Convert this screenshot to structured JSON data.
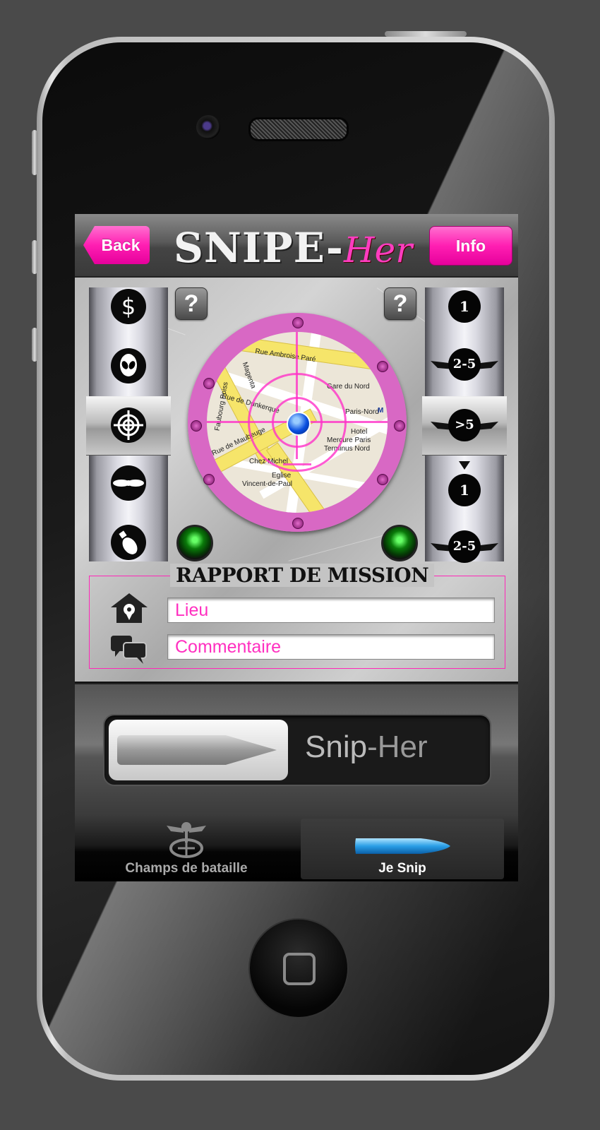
{
  "nav": {
    "back_label": "Back",
    "info_label": "Info",
    "logo_main": "SNIPE-",
    "logo_accent": "Her"
  },
  "left_dial": {
    "icons": [
      "dollar-icon",
      "alien-icon",
      "crosshair-icon",
      "propeller-icon",
      "bomb-icon"
    ],
    "selected": "crosshair-icon"
  },
  "right_dial": {
    "items": [
      "1",
      "2-5",
      ">5",
      "1",
      "2-5"
    ],
    "selected": ">5"
  },
  "help_label": "?",
  "map": {
    "streets": [
      "Rue Ambroise Paré",
      "Magenta",
      "Rue de Dunkerque",
      "Rue de Maubeuge",
      "Faubourg Poiss",
      "Gare du Nord",
      "Paris-Nord",
      "M",
      "Hotel",
      "Mercure Paris",
      "Terminus Nord",
      "Chez Michel",
      "Eglise",
      "Vincent-de-Paul"
    ]
  },
  "report": {
    "title": "RAPPORT DE MISSION",
    "place_placeholder": "Lieu",
    "comment_placeholder": "Commentaire"
  },
  "slider": {
    "text_main": "Snip",
    "text_accent": "-Her",
    "accent_color": "#ff1fb2"
  },
  "tabs": [
    {
      "label": "Champs de bataille",
      "active": false
    },
    {
      "label": "Je Snip",
      "active": true
    }
  ]
}
